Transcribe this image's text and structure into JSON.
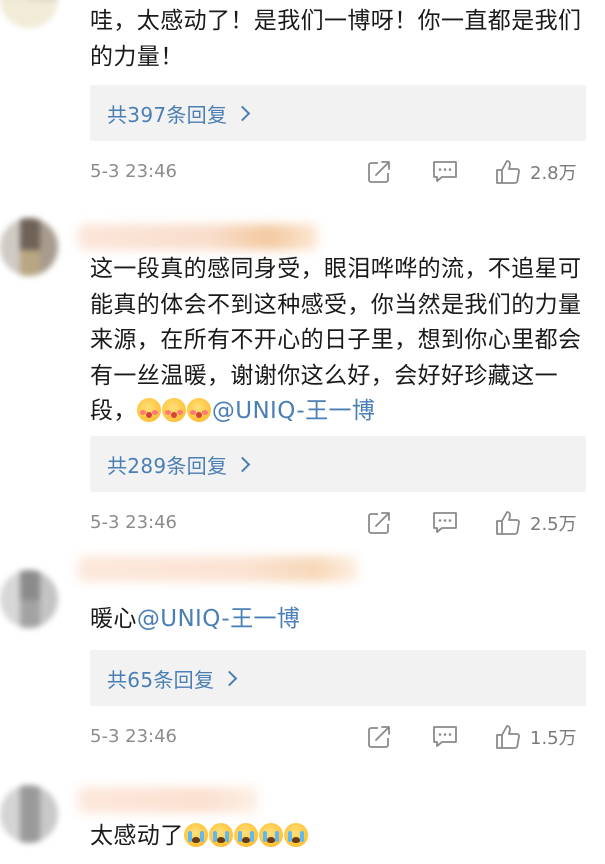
{
  "comments": [
    {
      "text": "哇，太感动了！是我们一博呀！你一直都是我们的力量！",
      "reply_link": "共397条回复",
      "timestamp": "5-3 23:46",
      "likes": "2.8万"
    },
    {
      "text": "这一段真的感同身受，眼泪哗哗的流，不追星可能真的体会不到这种感受，你当然是我们的力量来源，在所有不开心的日子里，想到你心里都会有一丝温暖，谢谢你这么好，会好好珍藏这一段，",
      "mention": "@UNIQ-王一博",
      "reply_link": "共289条回复",
      "timestamp": "5-3 23:46",
      "likes": "2.5万"
    },
    {
      "text": "暖心",
      "mention": "@UNIQ-王一博",
      "reply_link": "共65条回复",
      "timestamp": "5-3 23:46",
      "likes": "1.5万"
    },
    {
      "text": "太感动了"
    }
  ],
  "icons": {
    "share": "share-icon",
    "comment": "comment-icon",
    "like": "thumbs-up-icon",
    "reply_chevron": "chevron-right-icon",
    "emoji_blush": "blushing-face-emoji",
    "emoji_cry": "crying-face-emoji"
  },
  "colors": {
    "link": "#4a7fb5",
    "meta": "#8c8c8c",
    "reply_bg": "#f2f2f2"
  }
}
